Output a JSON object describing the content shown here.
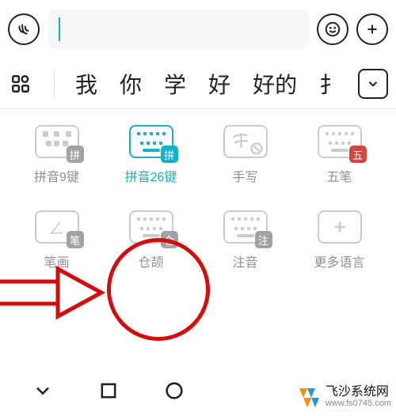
{
  "topbar": {
    "input_value": ""
  },
  "suggestions": {
    "items": [
      {
        "text": "我"
      },
      {
        "text": "你"
      },
      {
        "text": "学"
      },
      {
        "text": "好"
      },
      {
        "text": "好的"
      },
      {
        "text": "扌"
      }
    ]
  },
  "layouts": {
    "row1": [
      {
        "label": "拼音9键",
        "badge": "拼",
        "badge_color": "grey",
        "active": false,
        "kind": "nine"
      },
      {
        "label": "拼音26键",
        "badge": "拼",
        "badge_color": "active",
        "active": true,
        "kind": "full"
      },
      {
        "label": "手写",
        "badge": "",
        "active": false,
        "kind": "handwrite"
      },
      {
        "label": "五笔",
        "badge": "五",
        "badge_color": "red",
        "active": false,
        "kind": "full"
      }
    ],
    "row2": [
      {
        "label": "笔画",
        "badge": "笔",
        "badge_color": "grey",
        "active": false,
        "kind": "stroke"
      },
      {
        "label": "仓颉",
        "badge": "仓",
        "badge_color": "grey",
        "active": false,
        "kind": "full"
      },
      {
        "label": "注音",
        "badge": "注",
        "badge_color": "grey",
        "active": false,
        "kind": "full"
      },
      {
        "label": "更多语言",
        "badge": "",
        "active": false,
        "kind": "plus"
      }
    ]
  },
  "watermark": {
    "name": "飞沙系统网",
    "url": "www.fs0745.com"
  }
}
